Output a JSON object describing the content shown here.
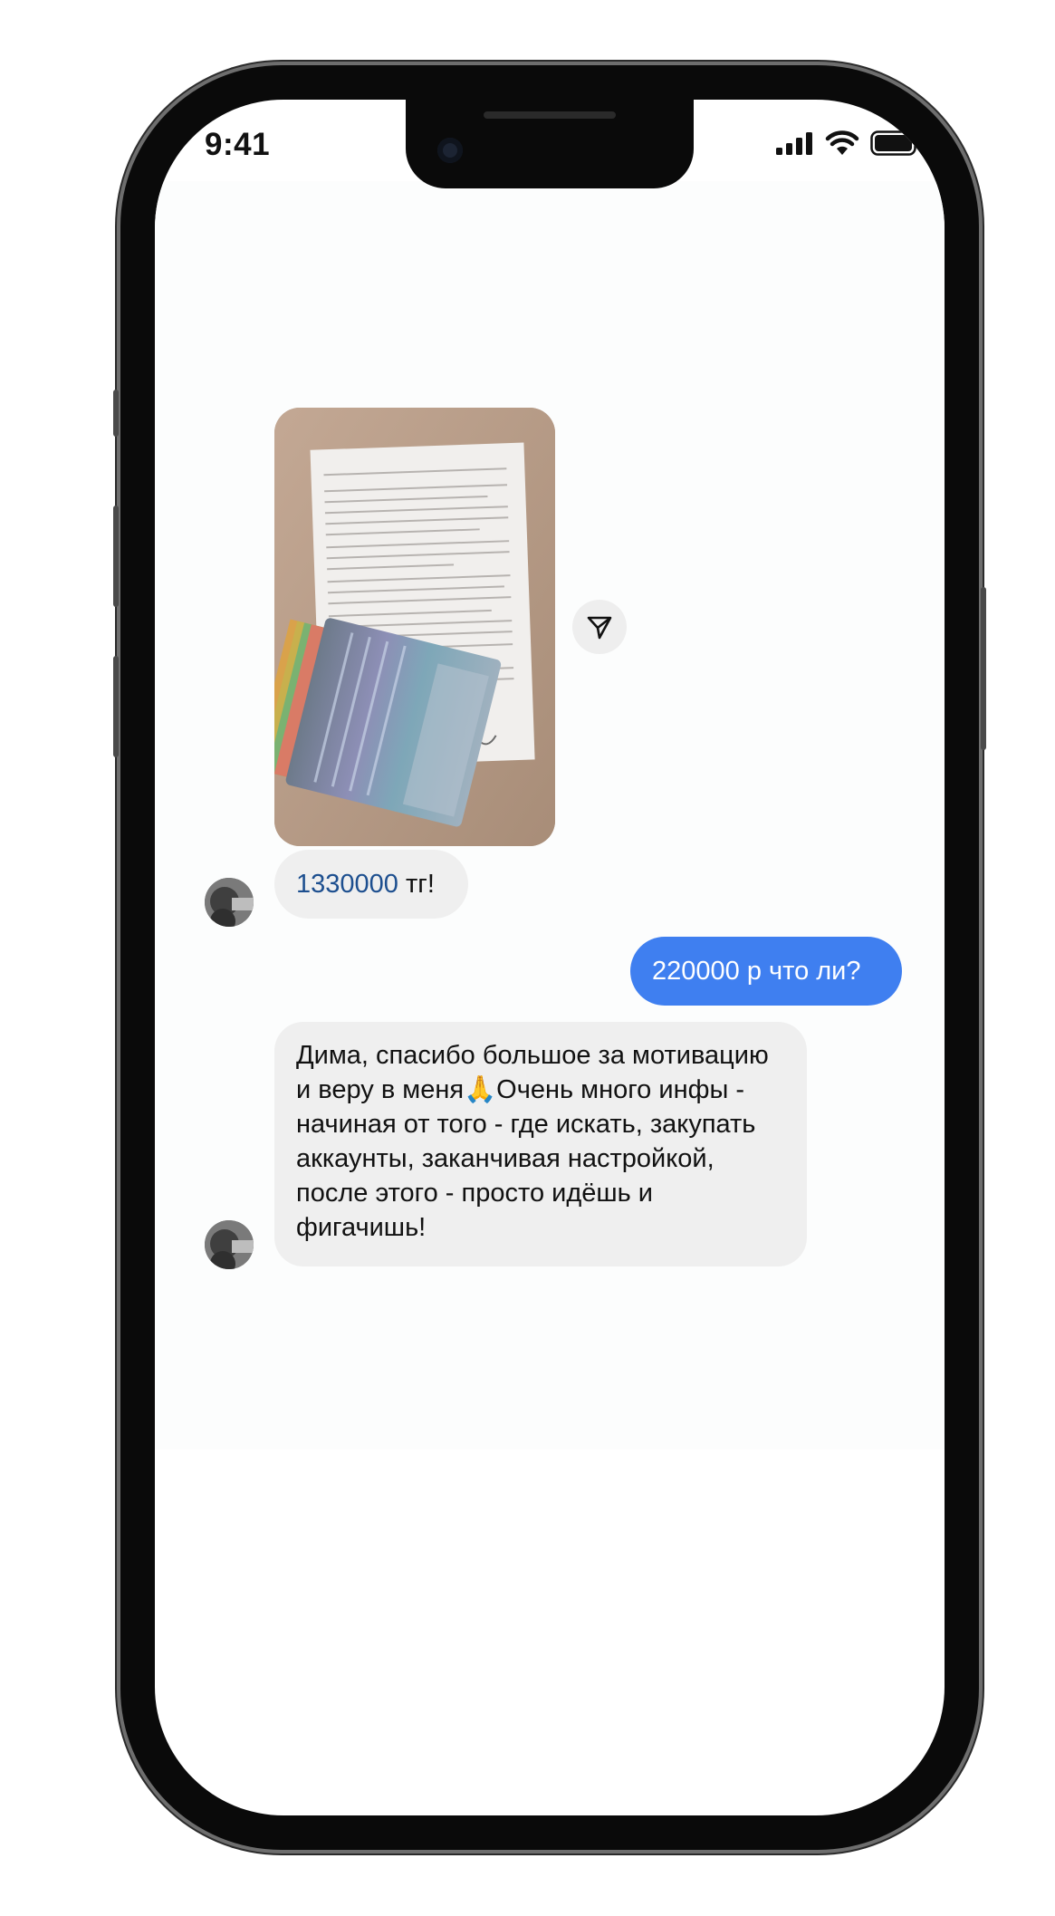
{
  "status_bar": {
    "time": "9:41"
  },
  "messages": [
    {
      "id": "incoming-1",
      "type": "incoming",
      "attachment": "photo-of-document-and-banknotes",
      "amount": "1330000",
      "text_suffix": " тг!"
    },
    {
      "id": "outgoing-1",
      "type": "outgoing",
      "text": "220000 р что ли?"
    },
    {
      "id": "incoming-2",
      "type": "incoming",
      "text": "Дима, спасибо большое за мотивацию и веру в меня🙏Очень много инфы - начиная от того - где искать, закупать аккаунты, заканчивая настройкой, после этого - просто идёшь и фигачишь!"
    }
  ],
  "colors": {
    "outgoing_bubble": "#3f7ff0",
    "incoming_bubble": "#efefef",
    "link_number": "#1d4f8f"
  },
  "icons": {
    "share": "paper-plane-icon",
    "signal": "signal-bars-icon",
    "wifi": "wifi-icon",
    "battery": "battery-icon"
  }
}
